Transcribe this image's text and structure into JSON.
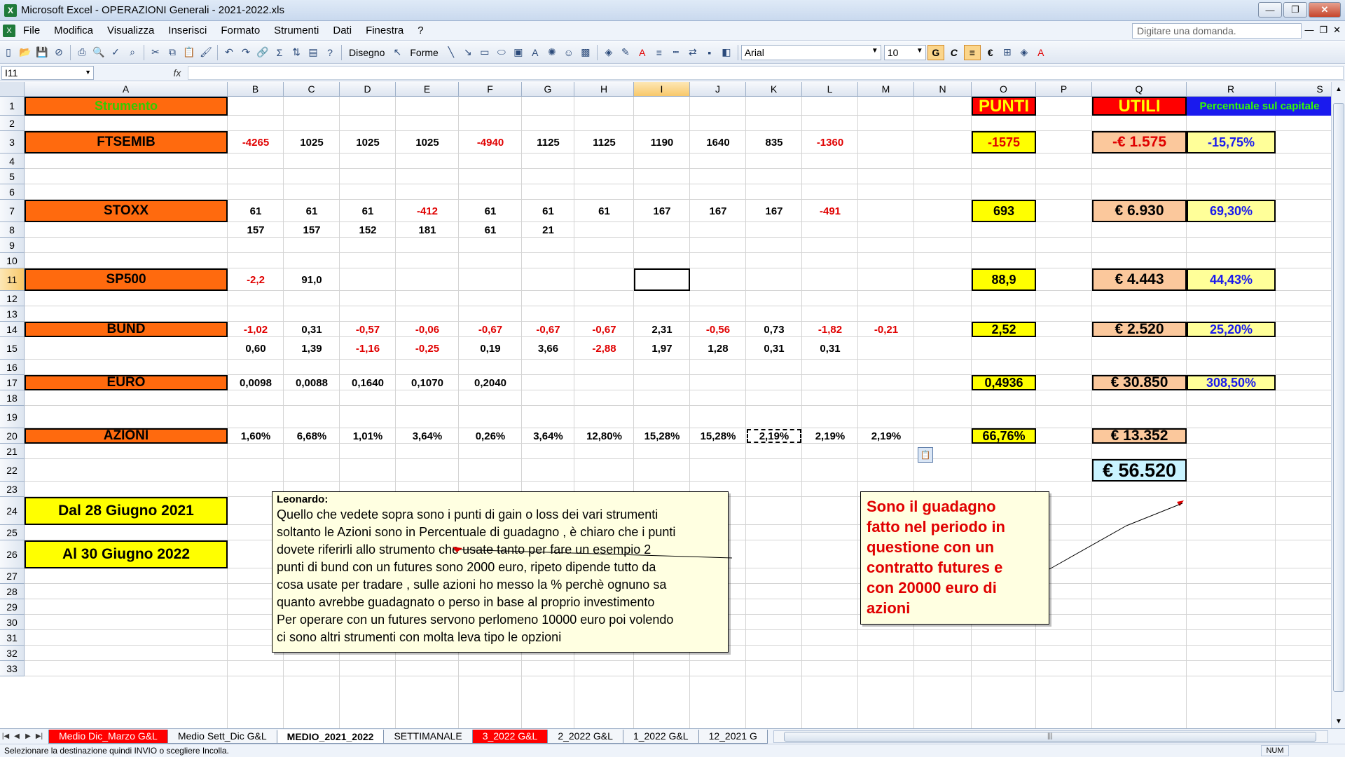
{
  "window": {
    "title": "Microsoft Excel - OPERAZIONI Generali - 2021-2022.xls",
    "app_icon": "excel-icon"
  },
  "menu": {
    "items": [
      "File",
      "Modifica",
      "Visualizza",
      "Inserisci",
      "Formato",
      "Strumenti",
      "Dati",
      "Finestra",
      "?"
    ],
    "help_placeholder": "Digitare una domanda."
  },
  "toolbar": {
    "draw_label": "Disegno",
    "shapes_label": "Forme",
    "font_name": "Arial",
    "font_size": "10",
    "bold_label": "G",
    "italic_label": "C"
  },
  "formula_bar": {
    "name_box": "I11",
    "fx_label": "fx",
    "formula": ""
  },
  "columns": [
    "A",
    "B",
    "C",
    "D",
    "E",
    "F",
    "G",
    "H",
    "I",
    "J",
    "K",
    "L",
    "M",
    "N",
    "O",
    "P",
    "Q",
    "R",
    "S"
  ],
  "rows": [
    "1",
    "2",
    "3",
    "4",
    "5",
    "6",
    "7",
    "8",
    "9",
    "10",
    "11",
    "12",
    "13",
    "14",
    "15",
    "16",
    "17",
    "18",
    "19",
    "20",
    "21",
    "22",
    "23",
    "24",
    "25",
    "26",
    "27",
    "28",
    "29",
    "30",
    "31",
    "32",
    "33"
  ],
  "headers": {
    "strumento": "Strumento",
    "punti": "PUNTI",
    "utili": "UTILI",
    "percentuale": "Percentuale sul capitale"
  },
  "instruments": {
    "ftsemib": {
      "label": "FTSEMIB",
      "r1": [
        "-4265",
        "1025",
        "1025",
        "1025",
        "-4940",
        "1125",
        "1125",
        "1190",
        "1640",
        "835",
        "-1360"
      ],
      "punti": "-1575",
      "utili": "-€ 1.575",
      "perc": "-15,75%"
    },
    "stoxx": {
      "label": "STOXX",
      "r1": [
        "61",
        "61",
        "61",
        "-412",
        "61",
        "61",
        "61",
        "167",
        "167",
        "167",
        "-491"
      ],
      "r2": [
        "157",
        "157",
        "152",
        "181",
        "61",
        "21"
      ],
      "punti": "693",
      "utili": "€ 6.930",
      "perc": "69,30%"
    },
    "sp500": {
      "label": "SP500",
      "r1": [
        "-2,2",
        "91,0"
      ],
      "punti": "88,9",
      "utili": "€ 4.443",
      "perc": "44,43%"
    },
    "bund": {
      "label": "BUND",
      "r1": [
        "-1,02",
        "0,31",
        "-0,57",
        "-0,06",
        "-0,67",
        "-0,67",
        "-0,67",
        "2,31",
        "-0,56",
        "0,73",
        "-1,82",
        "-0,21"
      ],
      "r2": [
        "0,60",
        "1,39",
        "-1,16",
        "-0,25",
        "0,19",
        "3,66",
        "-2,88",
        "1,97",
        "1,28",
        "0,31",
        "0,31"
      ],
      "punti": "2,52",
      "utili": "€ 2.520",
      "perc": "25,20%"
    },
    "euro": {
      "label": "EURO",
      "r1": [
        "0,0098",
        "0,0088",
        "0,1640",
        "0,1070",
        "0,2040"
      ],
      "punti": "0,4936",
      "utili": "€ 30.850",
      "perc": "308,50%"
    },
    "azioni": {
      "label": "AZIONI",
      "r1": [
        "1,60%",
        "6,68%",
        "1,01%",
        "3,64%",
        "0,26%",
        "3,64%",
        "12,80%",
        "15,28%",
        "15,28%",
        "2,19%",
        "2,19%",
        "2,19%"
      ],
      "punti": "66,76%",
      "utili": "€ 13.352"
    }
  },
  "total": "€ 56.520",
  "dates": {
    "from": "Dal 28 Giugno  2021",
    "to": "Al 30 Giugno 2022"
  },
  "comment1": {
    "author": "Leonardo:",
    "lines": [
      "Quello che vedete sopra sono i punti di gain o loss dei vari strumenti",
      "soltanto le Azioni sono in Percentuale di guadagno , è chiaro che i punti",
      "dovete riferirli allo strumento che usate tanto per fare un esempio 2",
      "punti di bund con un futures sono 2000 euro, ripeto dipende tutto da",
      "cosa usate per tradare , sulle azioni ho messo la % perchè ognuno sa",
      "quanto avrebbe guadagnato o perso in base al proprio investimento",
      "Per operare con un futures servono perlomeno 10000 euro poi volendo",
      "ci sono altri strumenti con molta leva tipo le opzioni"
    ]
  },
  "comment2": {
    "lines": [
      "Sono il guadagno",
      "fatto nel periodo in",
      "questione con un",
      "contratto futures e",
      "con 20000 euro di",
      "azioni"
    ]
  },
  "tabs": [
    {
      "label": "Medio Dic_Marzo G&L",
      "style": "red"
    },
    {
      "label": "Medio Sett_Dic G&L",
      "style": "normal"
    },
    {
      "label": "MEDIO_2021_2022",
      "style": "active"
    },
    {
      "label": "SETTIMANALE",
      "style": "normal"
    },
    {
      "label": "3_2022 G&L",
      "style": "red"
    },
    {
      "label": "2_2022 G&L",
      "style": "normal"
    },
    {
      "label": "1_2022 G&L",
      "style": "normal"
    },
    {
      "label": "12_2021 G",
      "style": "normal"
    }
  ],
  "status": {
    "message": "Selezionare la destinazione quindi INVIO o scegliere Incolla.",
    "num": "NUM"
  },
  "colors": {
    "orange_label": "#ff6a0e",
    "yellow": "#ffff00",
    "peach": "#fbc89c",
    "negative": "#e00000",
    "blue_text": "#1a1aee"
  }
}
